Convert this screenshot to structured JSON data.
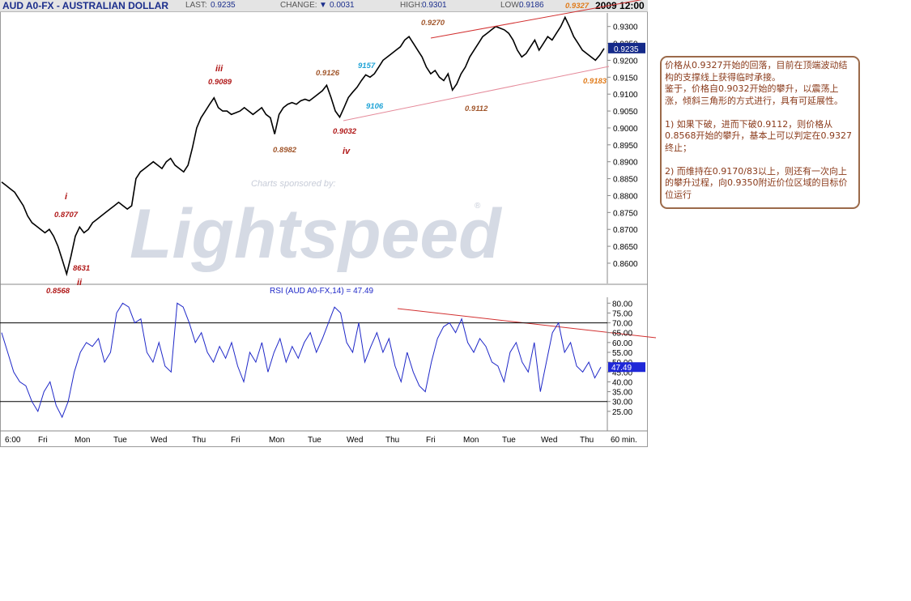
{
  "header": {
    "symbol": "AUD A0-FX - AUSTRALIAN DOLLAR",
    "last_label": "LAST:",
    "last": "0.9235",
    "change_label": "CHANGE:",
    "change": "0.0031",
    "high_label": "HIGH:",
    "high": "0.9301",
    "low_label": "LOW:",
    "low": "0.9186",
    "datetime": "2009 12:00"
  },
  "watermark": {
    "sponsor": "Charts sponsored by:",
    "brand": "Lightspeed",
    "reg": "®"
  },
  "colors": {
    "price": "#000000",
    "rsi": "#1f28c8",
    "trend": "#cc2222",
    "wave_red": "#b01818",
    "wave_brown": "#a0552a",
    "wave_cyan": "#1ea3d6",
    "wave_orange": "#e07b1a",
    "current_box": "#152a8a"
  },
  "chart_data": [
    {
      "type": "line",
      "series": [
        {
          "values": [
            0.884,
            0.883,
            0.882,
            0.881,
            0.879,
            0.877,
            0.874,
            0.872,
            0.871,
            0.87,
            0.869,
            0.87,
            0.868,
            0.865,
            0.861,
            0.8568,
            0.862,
            0.868,
            0.8707,
            0.869,
            0.87,
            0.872,
            0.873,
            0.874,
            0.875,
            0.876,
            0.877,
            0.878,
            0.877,
            0.876,
            0.877,
            0.885,
            0.887,
            0.888,
            0.889,
            0.89,
            0.889,
            0.888,
            0.89,
            0.891,
            0.889,
            0.888,
            0.887,
            0.889,
            0.894,
            0.9,
            0.903,
            0.905,
            0.907,
            0.9089,
            0.906,
            0.905,
            0.905,
            0.904,
            0.9045,
            0.905,
            0.906,
            0.905,
            0.904,
            0.905,
            0.906,
            0.904,
            0.903,
            0.8982,
            0.904,
            0.906,
            0.907,
            0.9075,
            0.907,
            0.908,
            0.9085,
            0.908,
            0.909,
            0.91,
            0.911,
            0.9126,
            0.909,
            0.905,
            0.9032,
            0.906,
            0.909,
            0.9106,
            0.912,
            0.914,
            0.9157,
            0.915,
            0.916,
            0.918,
            0.92,
            0.921,
            0.922,
            0.923,
            0.924,
            0.926,
            0.927,
            0.925,
            0.923,
            0.921,
            0.918,
            0.916,
            0.917,
            0.915,
            0.914,
            0.916,
            0.9112,
            0.913,
            0.916,
            0.918,
            0.921,
            0.923,
            0.925,
            0.927,
            0.928,
            0.929,
            0.93,
            0.9295,
            0.929,
            0.928,
            0.926,
            0.923,
            0.921,
            0.922,
            0.924,
            0.926,
            0.923,
            0.925,
            0.927,
            0.926,
            0.928,
            0.93,
            0.9327,
            0.93,
            0.927,
            0.925,
            0.923,
            0.922,
            0.921,
            0.92,
            0.9215,
            0.9235
          ]
        }
      ],
      "ylim": [
        0.854,
        0.934
      ],
      "yticks": [
        "0.9300",
        "0.9250",
        "0.9200",
        "0.9150",
        "0.9100",
        "0.9050",
        "0.9000",
        "0.8950",
        "0.8900",
        "0.8850",
        "0.8800",
        "0.8750",
        "0.8700",
        "0.8650",
        "0.8600"
      ],
      "current_value": "0.9235",
      "annotations": [
        {
          "text": "i",
          "style": "wave_red"
        },
        {
          "text": "0.8707",
          "style": "wave_red"
        },
        {
          "text": "ii",
          "style": "wave_red"
        },
        {
          "text": "0.8568",
          "style": "wave_red"
        },
        {
          "text": "8631",
          "style": "wave_red"
        },
        {
          "text": "iii",
          "style": "wave_red"
        },
        {
          "text": "0.9089",
          "style": "wave_red"
        },
        {
          "text": "0.8982",
          "style": "wave_brown"
        },
        {
          "text": "iv",
          "style": "wave_red"
        },
        {
          "text": "0.9032",
          "style": "wave_red"
        },
        {
          "text": "0.9126",
          "style": "wave_brown"
        },
        {
          "text": "9157",
          "style": "wave_cyan"
        },
        {
          "text": "9106",
          "style": "wave_cyan"
        },
        {
          "text": "0.9270",
          "style": "wave_brown"
        },
        {
          "text": "0.9112",
          "style": "wave_brown"
        },
        {
          "text": "0.9327",
          "style": "wave_orange"
        },
        {
          "text": "0.9183",
          "style": "wave_orange"
        }
      ]
    },
    {
      "type": "line",
      "title": "RSI (AUD A0-FX,14) = 47.49",
      "series": [
        {
          "values": [
            65,
            55,
            45,
            40,
            38,
            30,
            25,
            35,
            40,
            28,
            22,
            30,
            45,
            55,
            60,
            58,
            62,
            50,
            55,
            75,
            80,
            78,
            70,
            72,
            55,
            50,
            60,
            48,
            45,
            80,
            78,
            70,
            60,
            65,
            55,
            50,
            58,
            52,
            60,
            48,
            40,
            55,
            50,
            60,
            45,
            55,
            62,
            50,
            58,
            52,
            60,
            65,
            55,
            62,
            70,
            78,
            75,
            60,
            55,
            70,
            50,
            58,
            65,
            55,
            62,
            48,
            40,
            55,
            45,
            38,
            35,
            50,
            62,
            68,
            70,
            65,
            72,
            60,
            55,
            62,
            58,
            50,
            48,
            40,
            55,
            60,
            50,
            45,
            60,
            35,
            50,
            65,
            70,
            55,
            60,
            48,
            45,
            50,
            42,
            47.49
          ]
        }
      ],
      "ylim": [
        20,
        83
      ],
      "yticks": [
        "80.00",
        "75.00",
        "70.00",
        "65.00",
        "60.00",
        "55.00",
        "50.00",
        "45.00",
        "40.00",
        "35.00",
        "30.00",
        "25.00"
      ],
      "current_value": "47.49"
    }
  ],
  "x_axis_labels": [
    "6:00",
    "Fri",
    "Mon",
    "Tue",
    "Wed",
    "Thu",
    "Fri",
    "Mon",
    "Tue",
    "Wed",
    "Thu",
    "Fri",
    "Mon",
    "Tue",
    "Wed",
    "Thu",
    "60 min."
  ],
  "note_paragraphs": [
    "价格从0.9327开始的回落，目前在顶端波动结构的支撑线上获得临时承接。",
    "鉴于，价格自0.9032开始的攀升，以震荡上涨，倾斜三角形的方式进行，具有可延展性。",
    "",
    "1) 如果下破，进而下破0.9112，则价格从0.8568开始的攀升，基本上可以判定在0.9327终止；",
    "",
    "2) 而维持在0.9170/83以上，则还有一次向上的攀升过程，向0.9350附近价位区域的目标价位运行"
  ]
}
